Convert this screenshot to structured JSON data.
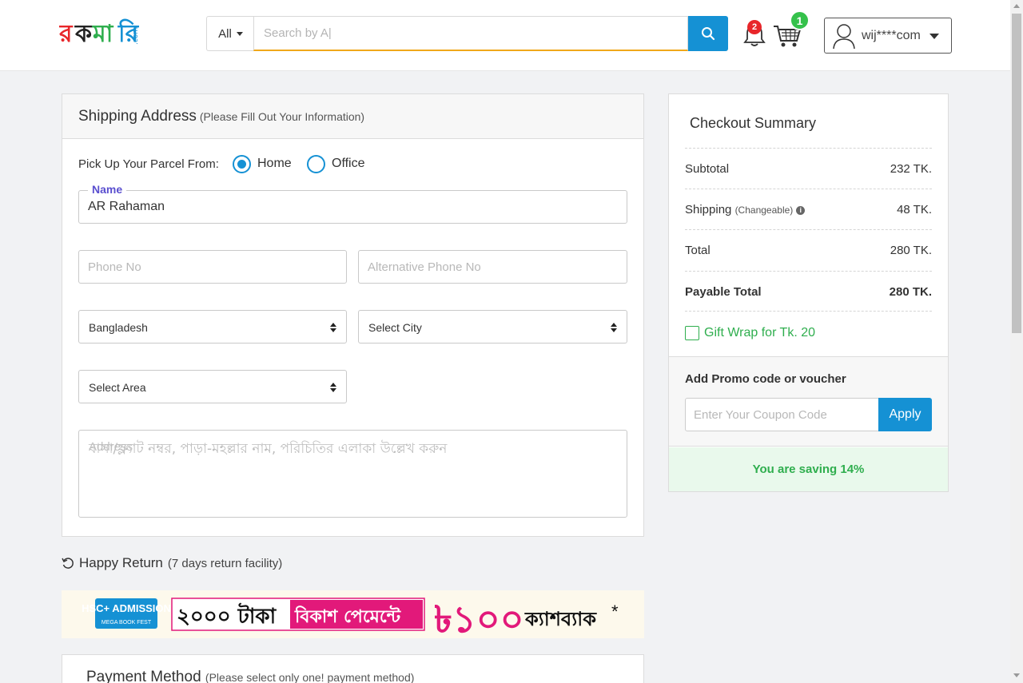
{
  "header": {
    "logo_alt": "rokomari.com",
    "category": "All",
    "search_placeholder": "Search by A|",
    "notification_count": "2",
    "cart_count": "1",
    "username": "wij****com"
  },
  "shipping": {
    "title": "Shipping Address",
    "subtitle": "(Please Fill Out Your Information)",
    "pickup_label": "Pick Up Your Parcel From:",
    "pickup_options": [
      "Home",
      "Office"
    ],
    "selected_pickup": "Home",
    "name_legend": "Name",
    "name_value": "AR Rahaman",
    "phone_placeholder": "Phone No",
    "alt_phone_placeholder": "Alternative Phone No",
    "country": "Bangladesh",
    "city": "Select City",
    "area": "Select Area",
    "address_label": "Address",
    "address_placeholder": "বাসা/ফ্ল্যাট নম্বর, পাড়া-মহল্লার নাম, পরিচিতির এলাকা উল্লেখ করুন"
  },
  "happy_return": {
    "title": "Happy Return",
    "subtitle": "(7 days return facility)"
  },
  "banner": {
    "text_main": "২০০০ টাকা",
    "text_bkash": "বিকাশ পেমেন্টে",
    "text_amount": "৳১০০",
    "text_cashback": "ক্যাশব্যাক",
    "badge_text": "HSC+ ADMISSION",
    "badge_sub": "MEGA BOOK FEST"
  },
  "payment": {
    "title": "Payment Method",
    "subtitle": "(Please select only one! payment method)"
  },
  "summary": {
    "title": "Checkout Summary",
    "rows": [
      {
        "label": "Subtotal",
        "value": "232 TK."
      },
      {
        "label": "Shipping",
        "note": "(Changeable)",
        "value": "48 TK."
      },
      {
        "label": "Total",
        "value": "280 TK."
      },
      {
        "label": "Payable Total",
        "value": "280 TK."
      }
    ],
    "gift_wrap": "Gift Wrap for Tk. 20",
    "promo_title": "Add Promo code or voucher",
    "coupon_placeholder": "Enter Your Coupon Code",
    "apply_label": "Apply",
    "saving_text": "You are saving 14%"
  },
  "colors": {
    "primary_blue": "#1591d4",
    "green": "#2fae4e",
    "search_underline": "#f0a81a",
    "badge_red": "#e8262a",
    "badge_green": "#35c14b",
    "banner_pink": "#e2197a"
  }
}
